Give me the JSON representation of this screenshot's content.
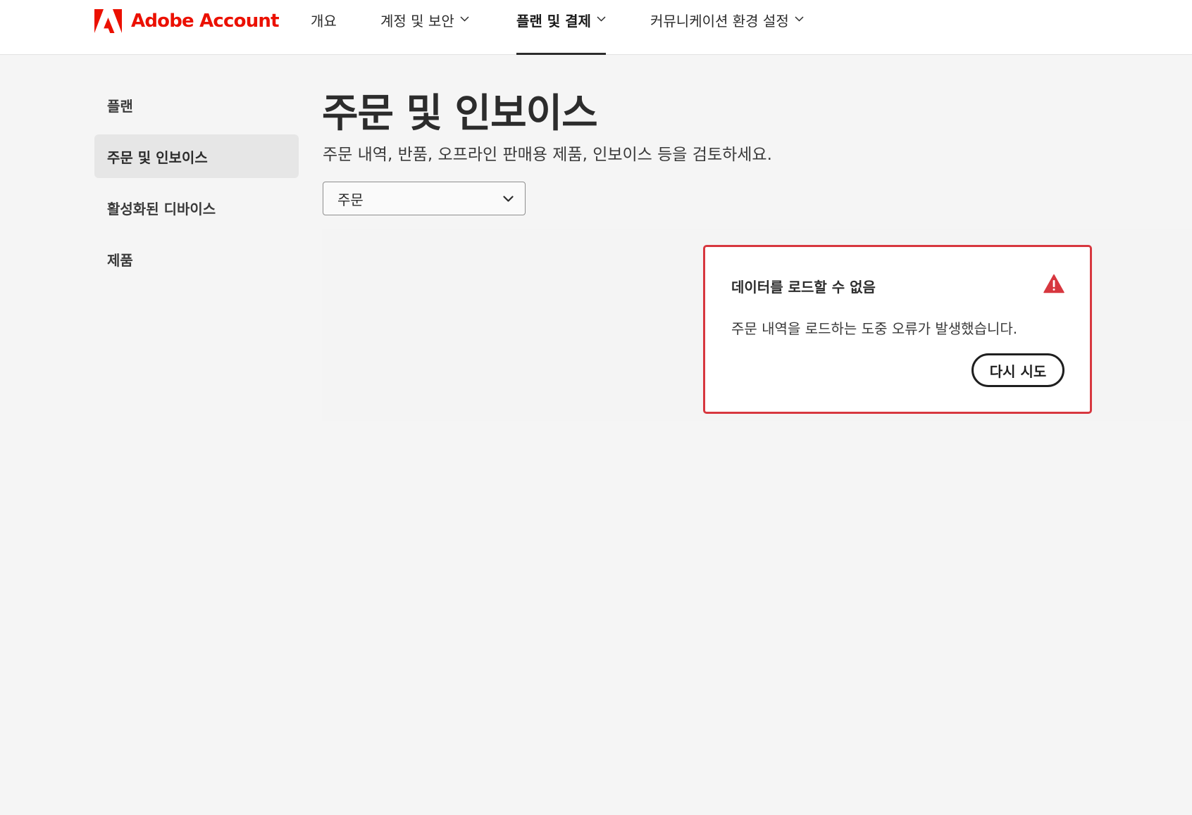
{
  "header": {
    "brand": "Adobe Account",
    "nav": [
      {
        "label": "개요",
        "has_dropdown": false,
        "active": false
      },
      {
        "label": "계정 및 보안",
        "has_dropdown": true,
        "active": false
      },
      {
        "label": "플랜 및 결제",
        "has_dropdown": true,
        "active": true
      },
      {
        "label": "커뮤니케이션 환경 설정",
        "has_dropdown": true,
        "active": false
      }
    ]
  },
  "sidebar": {
    "items": [
      {
        "label": "플랜",
        "selected": false
      },
      {
        "label": "주문 및 인보이스",
        "selected": true
      },
      {
        "label": "활성화된 디바이스",
        "selected": false
      },
      {
        "label": "제품",
        "selected": false
      }
    ]
  },
  "main": {
    "title": "주문 및 인보이스",
    "description": "주문 내역, 반품, 오프라인 판매용 제품, 인보이스 등을 검토하세요.",
    "filter_select": {
      "value": "주문"
    }
  },
  "error": {
    "title": "데이터를 로드할 수 없음",
    "message": "주문 내역을 로드하는 도중 오류가 발생했습니다.",
    "retry_label": "다시 시도"
  },
  "colors": {
    "brand": "#eb1000",
    "error_border": "#d7373f",
    "page_bg": "#f5f5f5"
  },
  "icons": [
    "adobe-logo-icon",
    "chevron-down-icon",
    "alert-triangle-icon"
  ]
}
